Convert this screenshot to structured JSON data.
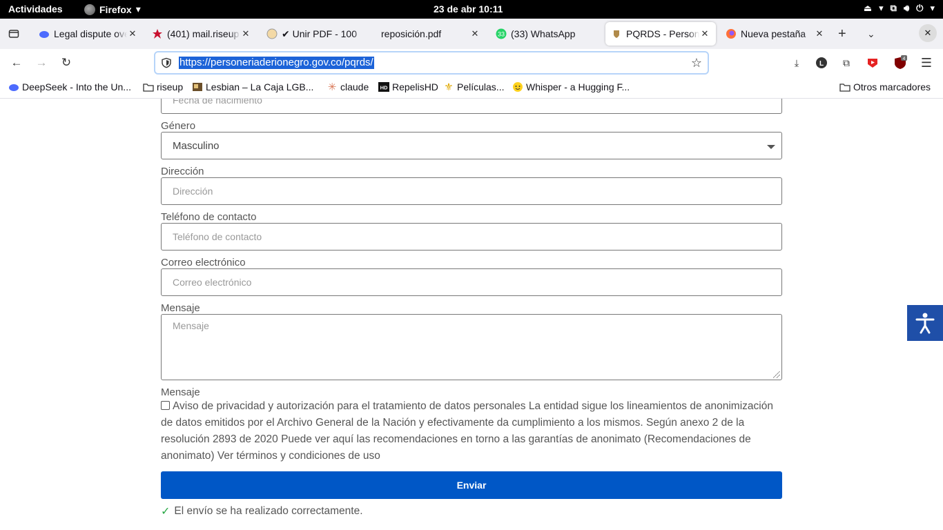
{
  "topbar": {
    "activities": "Actividades",
    "app": "Firefox",
    "clock": "23 de abr  10:11"
  },
  "tabs": [
    {
      "title": "Legal dispute over",
      "icon": "deepseek-icon"
    },
    {
      "title": "(401) mail.riseup",
      "icon": "riseup-icon"
    },
    {
      "title": "✔ Unir PDF - 100",
      "icon": "pdf-tool-icon"
    },
    {
      "title": "reposición.pdf",
      "icon": ""
    },
    {
      "title": "(33) WhatsApp",
      "icon": "whatsapp-icon",
      "badge": "33"
    },
    {
      "title": "PQRDS - Person",
      "icon": "seal-icon",
      "active": true
    },
    {
      "title": "Nueva pestaña",
      "icon": "firefox-icon"
    }
  ],
  "navbar": {
    "url": "https://personeriaderionegro.gov.co/pqrds/",
    "extension_badge": "4",
    "account_letter": "L"
  },
  "bookmarks": {
    "items": [
      "DeepSeek - Into the Un...",
      "riseup",
      "Lesbian – La Caja LGB...",
      "claude",
      "RepelisHD",
      "Películas...",
      "Whisper - a Hugging F..."
    ],
    "other": "Otros marcadores"
  },
  "form": {
    "birth_placeholder": "Fecha de nacimiento",
    "gender_label": "Género",
    "gender_value": "Masculino",
    "address_label": "Dirección",
    "address_placeholder": "Dirección",
    "phone_label": "Teléfono de contacto",
    "phone_placeholder": "Teléfono de contacto",
    "email_label": "Correo electrónico",
    "email_placeholder": "Correo electrónico",
    "message_label": "Mensaje",
    "message_placeholder": "Mensaje",
    "message_label_2": "Mensaje",
    "privacy_text": "Aviso de privacidad y autorización para el tratamiento de datos personales La entidad sigue los lineamientos de anonimización de datos emitidos por el Archivo General de la Nación y efectivamente da cumplimiento a los mismos. Según anexo 2 de la resolución 2893 de 2020 Puede ver aquí las recomendaciones en torno a las garantías de anonimato (Recomendaciones de anonimato) Ver términos y condiciones de uso",
    "privacy_checked": false,
    "submit_label": "Enviar",
    "success_message": "El envío se ha realizado correctamente."
  },
  "colors": {
    "submit": "#0057c6",
    "a11y": "#1f4fa8",
    "success_check": "#28a745"
  }
}
